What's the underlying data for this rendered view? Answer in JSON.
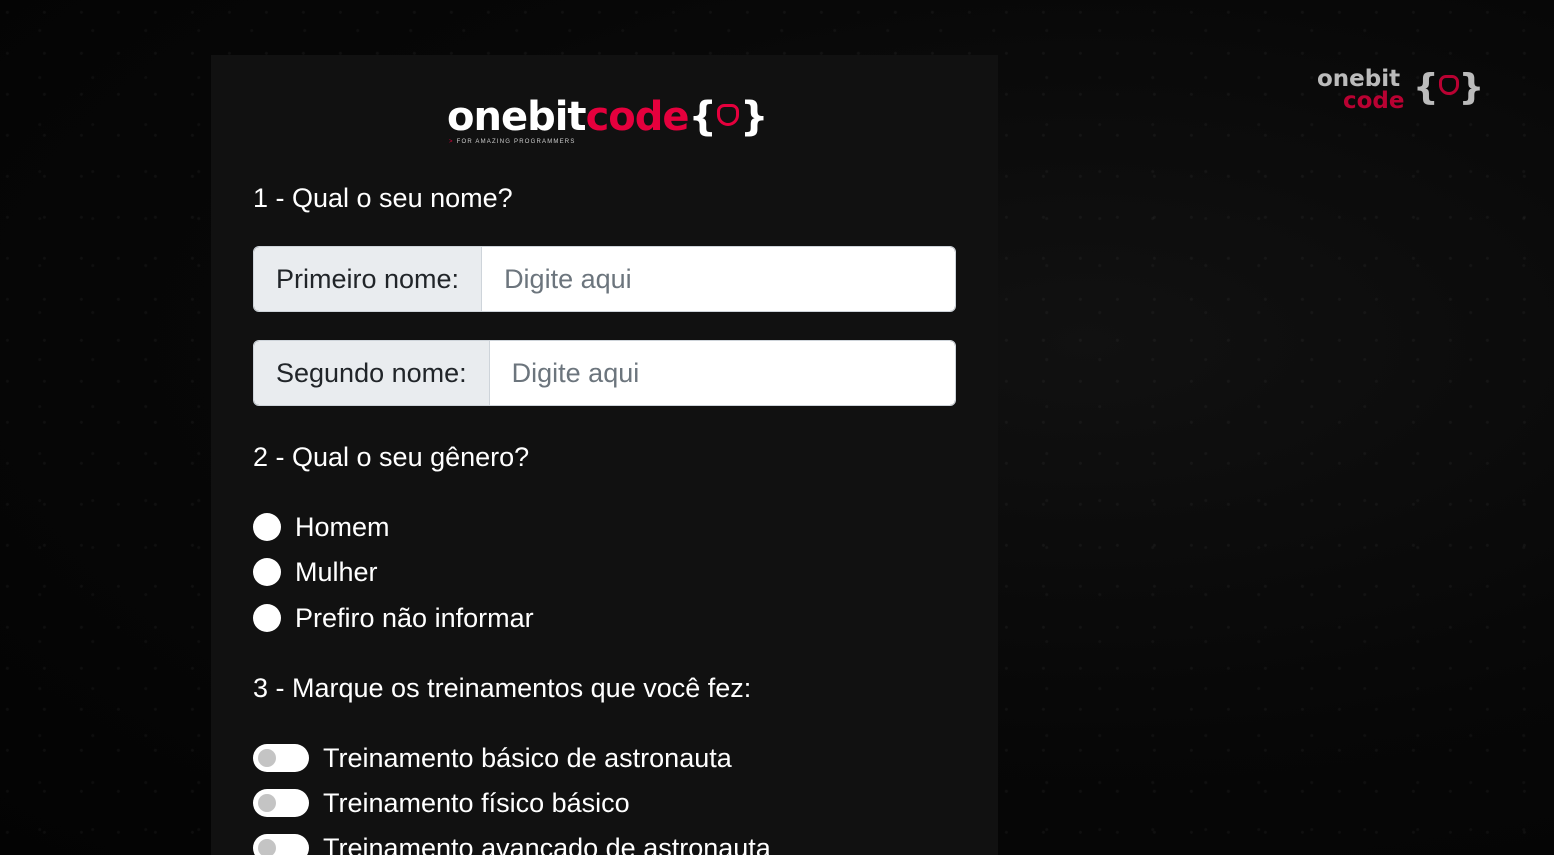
{
  "brand": {
    "logo_part1": "onebit",
    "logo_part2": "code",
    "brace_open": "{",
    "brace_close": "}",
    "tagline": "FOR AMAZING PROGRAMMERS",
    "tagline_arrow": ">",
    "corner_logo_part1": "onebit",
    "corner_logo_part2": "code",
    "accent_color": "#e5003d"
  },
  "form": {
    "q1": "1 - Qual o seu nome?",
    "first_name": {
      "label": "Primeiro nome:",
      "placeholder": "Digite aqui",
      "value": ""
    },
    "last_name": {
      "label": "Segundo nome:",
      "placeholder": "Digite aqui",
      "value": ""
    },
    "q2": "2 - Qual o seu gênero?",
    "gender_options": [
      {
        "label": "Homem",
        "checked": false
      },
      {
        "label": "Mulher",
        "checked": false
      },
      {
        "label": "Prefiro não informar",
        "checked": false
      }
    ],
    "q3": "3 - Marque os treinamentos que você fez:",
    "trainings": [
      {
        "label": "Treinamento básico de astronauta",
        "checked": false
      },
      {
        "label": "Treinamento físico básico",
        "checked": false
      },
      {
        "label": "Treinamento avançado de astronauta",
        "checked": false
      }
    ]
  }
}
